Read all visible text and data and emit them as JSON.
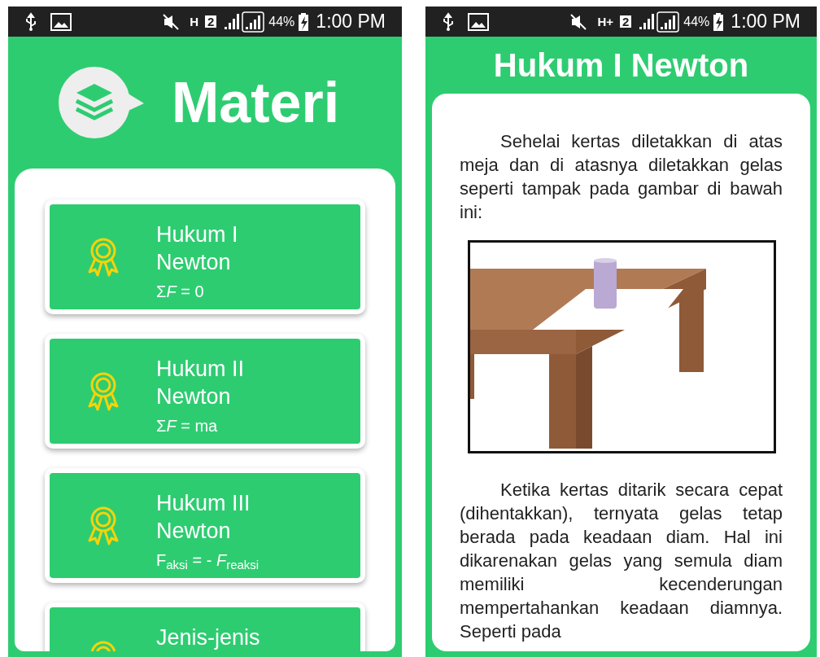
{
  "screens": [
    {
      "status_bar": {
        "network": "H",
        "sim": "2",
        "battery": "44%",
        "time": "1:00 PM"
      },
      "header": {
        "title": "Materi"
      },
      "items": [
        {
          "title": "Hukum I Newton",
          "formula": [
            "Σ",
            "*F*",
            " = 0"
          ]
        },
        {
          "title": "Hukum II Newton",
          "formula": [
            "Σ",
            "*F*",
            " = ma"
          ]
        },
        {
          "title": "Hukum III Newton",
          "formula": [
            "F",
            "$_{aksi}$",
            " = - ",
            "*F*",
            "$_{reaksi}$"
          ]
        },
        {
          "title": "Jenis-jenis"
        }
      ]
    },
    {
      "status_bar": {
        "network": "H+",
        "sim": "2",
        "battery": "44%",
        "time": "1:00 PM"
      },
      "title": "Hukum I Newton",
      "paragraphs": [
        "Sehelai kertas diletakkan di atas meja dan di atasnya diletakkan gelas seperti tampak pada gambar di bawah ini:",
        "Ketika kertas ditarik secara cepat (dihentakkan), ternyata gelas tetap berada pada keadaan diam. Hal ini dikarenakan gelas yang semula diam memiliki kecenderungan mempertahankan keadaan diamnya. Seperti pada"
      ]
    }
  ]
}
